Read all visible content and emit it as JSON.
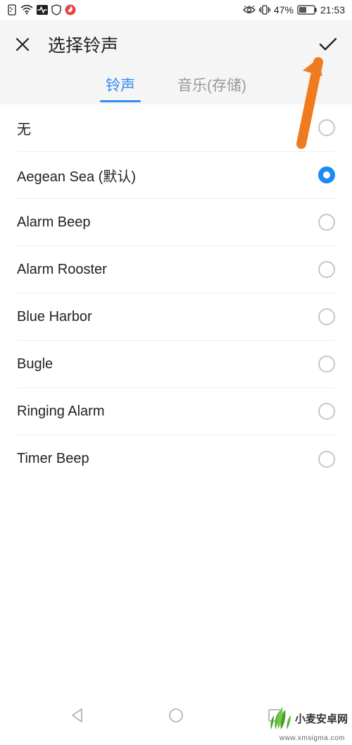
{
  "status": {
    "battery_pct": "47%",
    "time": "21:53"
  },
  "header": {
    "title": "选择铃声"
  },
  "tabs": {
    "ringtone": "铃声",
    "music": "音乐(存储)"
  },
  "ringtones": [
    {
      "label": "无",
      "selected": false
    },
    {
      "label": "Aegean Sea (默认)",
      "selected": true
    },
    {
      "label": "Alarm Beep",
      "selected": false
    },
    {
      "label": "Alarm Rooster",
      "selected": false
    },
    {
      "label": "Blue Harbor",
      "selected": false
    },
    {
      "label": "Bugle",
      "selected": false
    },
    {
      "label": "Ringing Alarm",
      "selected": false
    },
    {
      "label": "Timer Beep",
      "selected": false
    }
  ],
  "watermark": {
    "text": "小麦安卓网",
    "url": "www.xmsigma.com"
  }
}
